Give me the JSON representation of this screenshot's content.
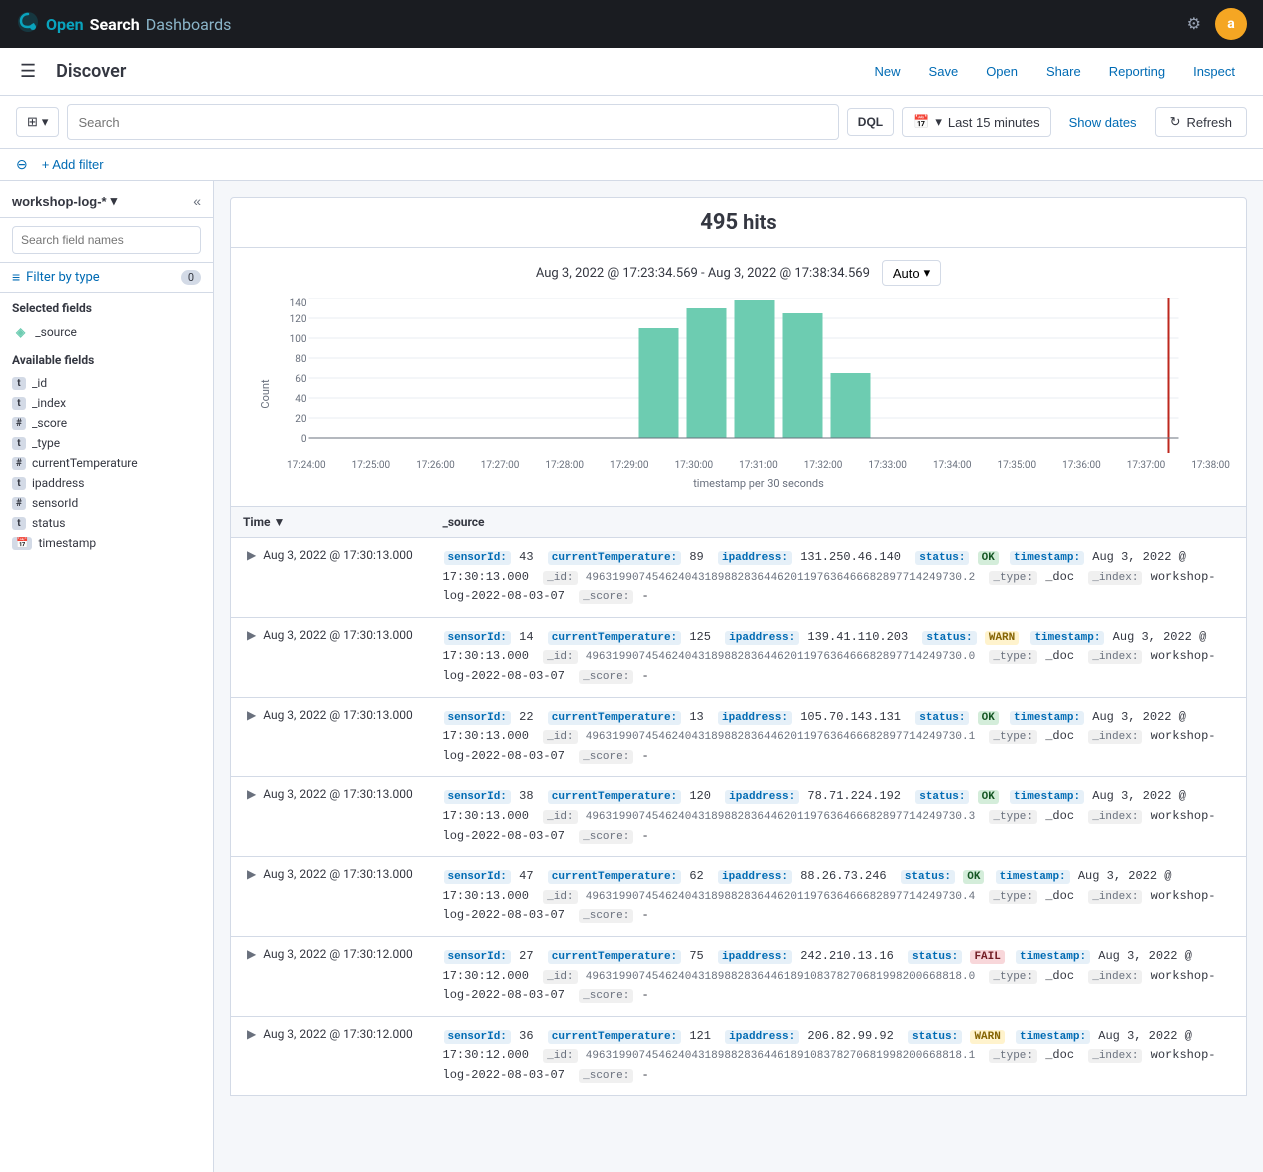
{
  "topNav": {
    "brand": "OpenSearch Dashboards",
    "settingsIcon": "⚙",
    "avatarLabel": "a"
  },
  "appBar": {
    "hamburgerIcon": "☰",
    "title": "Discover",
    "links": [
      "New",
      "Save",
      "Open",
      "Share",
      "Reporting",
      "Inspect"
    ]
  },
  "toolbar": {
    "searchPlaceholder": "Search",
    "dqlLabel": "DQL",
    "calendarIcon": "📅",
    "timeRange": "Last 15 minutes",
    "showDatesLabel": "Show dates",
    "refreshLabel": "Refresh",
    "refreshIcon": "↻",
    "chevronDown": "▾"
  },
  "filterBar": {
    "addFilterLabel": "+ Add filter"
  },
  "sidebar": {
    "indexPattern": "workshop-log-*",
    "chevron": "▾",
    "collapseIcon": "«",
    "searchFieldsPlaceholder": "Search field names",
    "filterByType": "Filter by type",
    "filterBadge": "0",
    "filterIcon": "≡",
    "selectedFieldsTitle": "Selected fields",
    "selectedFields": [
      {
        "name": "_source",
        "typeIcon": "◈",
        "typeClass": "type-source"
      }
    ],
    "availableFieldsTitle": "Available fields",
    "availableFields": [
      {
        "name": "_id",
        "typeLabel": "t",
        "typeClass": "type-t"
      },
      {
        "name": "_index",
        "typeLabel": "t",
        "typeClass": "type-t"
      },
      {
        "name": "_score",
        "typeLabel": "#",
        "typeClass": "type-hash"
      },
      {
        "name": "_type",
        "typeLabel": "t",
        "typeClass": "type-t"
      },
      {
        "name": "currentTemperature",
        "typeLabel": "#",
        "typeClass": "type-hash"
      },
      {
        "name": "ipaddress",
        "typeLabel": "t",
        "typeClass": "type-t"
      },
      {
        "name": "sensorId",
        "typeLabel": "#",
        "typeClass": "type-hash"
      },
      {
        "name": "status",
        "typeLabel": "t",
        "typeClass": "type-t"
      },
      {
        "name": "timestamp",
        "typeLabel": "📅",
        "typeClass": "type-cal"
      }
    ]
  },
  "chart": {
    "hitsLabel": "495 hits",
    "hitsCount": "495",
    "dateRange": "Aug 3, 2022 @ 17:23:34.569 - Aug 3, 2022 @ 17:38:34.569",
    "autoLabel": "Auto",
    "xAxisLabel": "timestamp per 30 seconds",
    "yAxisLabel": "Count",
    "xTicks": [
      "17:24:00",
      "17:25:00",
      "17:26:00",
      "17:27:00",
      "17:28:00",
      "17:29:00",
      "17:30:00",
      "17:31:00",
      "17:32:00",
      "17:33:00",
      "17:34:00",
      "17:35:00",
      "17:36:00",
      "17:37:00",
      "17:38:00"
    ],
    "yTicks": [
      0,
      20,
      40,
      60,
      80,
      100,
      120,
      140
    ],
    "bars": [
      {
        "x": 0,
        "height": 0
      },
      {
        "x": 1,
        "height": 0
      },
      {
        "x": 2,
        "height": 0
      },
      {
        "x": 3,
        "height": 0
      },
      {
        "x": 4,
        "height": 0
      },
      {
        "x": 5,
        "height": 110
      },
      {
        "x": 6,
        "height": 130
      },
      {
        "x": 7,
        "height": 140
      },
      {
        "x": 8,
        "height": 125
      },
      {
        "x": 9,
        "height": 65
      },
      {
        "x": 10,
        "height": 0
      },
      {
        "x": 11,
        "height": 0
      },
      {
        "x": 12,
        "height": 0
      },
      {
        "x": 13,
        "height": 0
      },
      {
        "x": 14,
        "height": 0
      }
    ]
  },
  "tableHeaders": [
    "Time",
    "_source"
  ],
  "rows": [
    {
      "time": "Aug 3, 2022 @ 17:30:13.000",
      "sensorId": "43",
      "currentTemperature": "89",
      "ipaddress": "131.250.46.140",
      "status": "OK",
      "timestamp": "Aug 3, 2022 @ 17:30:13.000",
      "_id": "496319907454624043189882836446201197636466682897714249730.2",
      "_type": "_doc",
      "_index": "workshop-log-2022-08-03-07",
      "_score": "-"
    },
    {
      "time": "Aug 3, 2022 @ 17:30:13.000",
      "sensorId": "14",
      "currentTemperature": "125",
      "ipaddress": "139.41.110.203",
      "status": "WARN",
      "timestamp": "Aug 3, 2022 @ 17:30:13.000",
      "_id": "496319907454624043189882836446201197636466682897714249730.0",
      "_type": "_doc",
      "_index": "workshop-log-2022-08-03-07",
      "_score": "-"
    },
    {
      "time": "Aug 3, 2022 @ 17:30:13.000",
      "sensorId": "22",
      "currentTemperature": "13",
      "ipaddress": "105.70.143.131",
      "status": "OK",
      "timestamp": "Aug 3, 2022 @ 17:30:13.000",
      "_id": "496319907454624043189882836446201197636466682897714249730.1",
      "_type": "_doc",
      "_index": "workshop-log-2022-08-03-07",
      "_score": "-"
    },
    {
      "time": "Aug 3, 2022 @ 17:30:13.000",
      "sensorId": "38",
      "currentTemperature": "120",
      "ipaddress": "78.71.224.192",
      "status": "OK",
      "timestamp": "Aug 3, 2022 @ 17:30:13.000",
      "_id": "496319907454624043189882836446201197636466682897714249730.3",
      "_type": "_doc",
      "_index": "workshop-log-2022-08-03-07",
      "_score": "-"
    },
    {
      "time": "Aug 3, 2022 @ 17:30:13.000",
      "sensorId": "47",
      "currentTemperature": "62",
      "ipaddress": "88.26.73.246",
      "status": "OK",
      "timestamp": "Aug 3, 2022 @ 17:30:13.000",
      "_id": "496319907454624043189882836446201197636466682897714249730.4",
      "_type": "_doc",
      "_index": "workshop-log-2022-08-03-07",
      "_score": "-"
    },
    {
      "time": "Aug 3, 2022 @ 17:30:12.000",
      "sensorId": "27",
      "currentTemperature": "75",
      "ipaddress": "242.210.13.16",
      "status": "FAIL",
      "timestamp": "Aug 3, 2022 @ 17:30:12.000",
      "_id": "496319907454624043189882836446189108378270681998200668818.0",
      "_type": "_doc",
      "_index": "workshop-log-2022-08-03-07",
      "_score": "-"
    },
    {
      "time": "Aug 3, 2022 @ 17:30:12.000",
      "sensorId": "36",
      "currentTemperature": "121",
      "ipaddress": "206.82.99.92",
      "status": "WARN",
      "timestamp": "Aug 3, 2022 @ 17:30:12.000",
      "_id": "496319907454624043189882836446189108378270681998200668818.1",
      "_type": "_doc",
      "_index": "workshop-log-2022-08-03-07",
      "_score": "-"
    }
  ]
}
